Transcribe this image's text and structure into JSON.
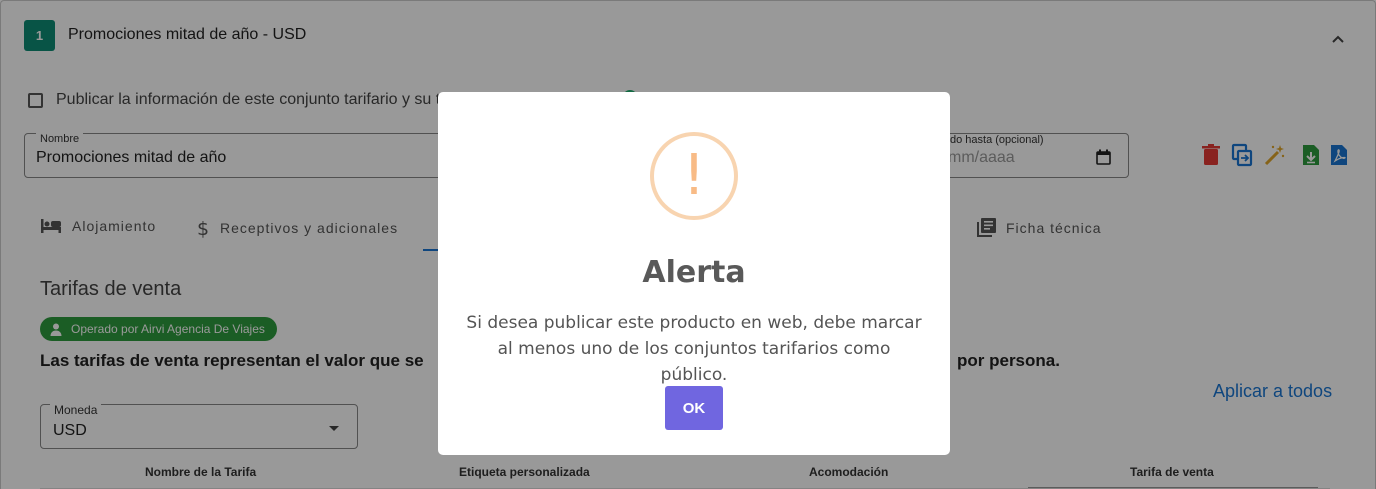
{
  "panel": {
    "step_number": "1",
    "title": "Promociones mitad de año - USD",
    "publish_checkbox_label": "Publicar la información de este conjunto tarifario y su t",
    "publish_checked": false
  },
  "form": {
    "name_label": "Nombre",
    "name_value": "Promociones mitad de año",
    "valid_until_label": "do hasta (opcional)",
    "valid_until_placeholder": "mm/aaaa"
  },
  "toolbar": {
    "icons": [
      "delete-icon",
      "copy-icon",
      "magic-wand-icon",
      "download-icon",
      "pdf-icon"
    ],
    "colors": {
      "delete": "#e53935",
      "copy": "#1976d2",
      "magic": "#e0a52b",
      "download": "#2e9b3e",
      "pdf": "#1976d2"
    }
  },
  "tabs": [
    {
      "label": "Alojamiento",
      "icon": "bed-icon"
    },
    {
      "label": "Receptivos y adicionales",
      "icon": "dollar-icon"
    },
    {
      "label": "Ficha técnica",
      "icon": "library-books-icon"
    }
  ],
  "pricing": {
    "section_title": "Tarifas de venta",
    "operator_chip": "Operado por Airvi Agencia De Viajes",
    "description_left": "Las tarifas de venta representan el valor que se",
    "description_right": "por persona.",
    "apply_all": "Aplicar a todos",
    "currency_label": "Moneda",
    "currency_value": "USD",
    "table_headers": [
      "Nombre de la Tarifa",
      "Etiqueta personalizada",
      "Acomodación",
      "Tarifa de venta"
    ]
  },
  "modal": {
    "icon": "warning-icon",
    "icon_glyph": "!",
    "title": "Alerta",
    "message": "Si desea publicar este producto en web, debe marcar al menos uno de los conjuntos tarifarios como público.",
    "ok_label": "OK",
    "accent": "#7066e0"
  },
  "colors": {
    "brand_teal": "#0e8c76",
    "link_blue": "#1976d2",
    "chip_green": "#2e9b3e"
  }
}
